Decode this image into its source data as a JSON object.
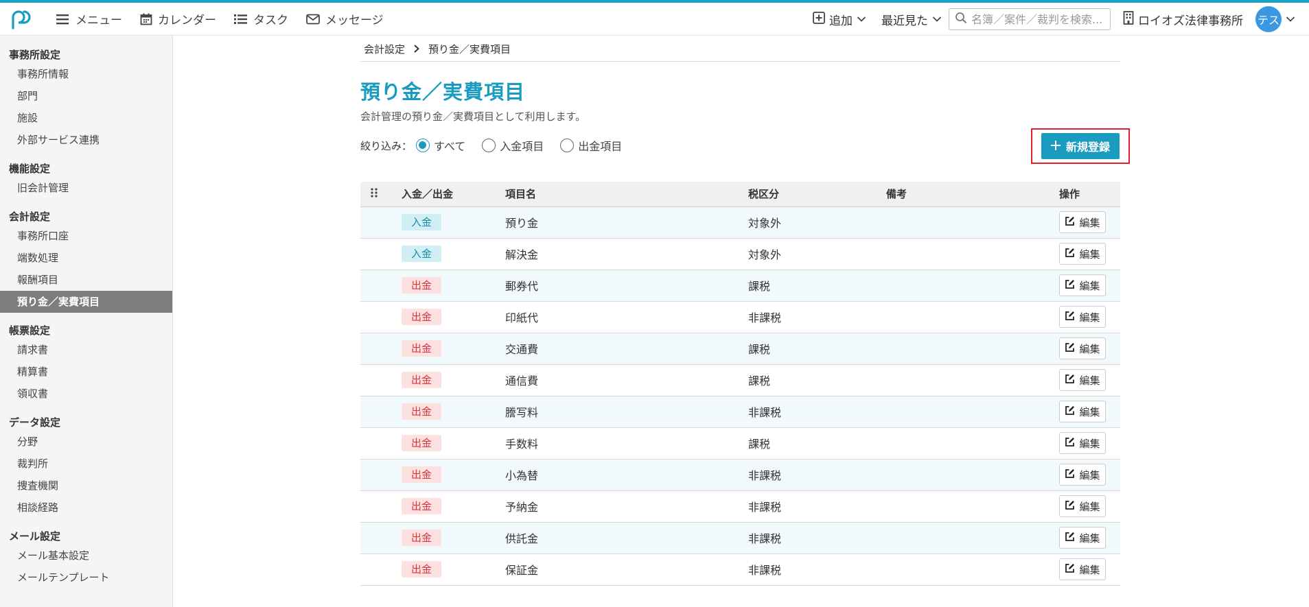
{
  "colors": {
    "accent": "#1a9bc0",
    "highlight": "#e0202a",
    "income": "#1a8aa8",
    "expense": "#d9363e"
  },
  "header": {
    "logo_icon": "app-logo-icon",
    "nav": [
      {
        "icon": "menu-icon",
        "label": "メニュー"
      },
      {
        "icon": "calendar-icon",
        "label": "カレンダー"
      },
      {
        "icon": "task-list-icon",
        "label": "タスク"
      },
      {
        "icon": "envelope-icon",
        "label": "メッセージ"
      }
    ],
    "add_label": "追加",
    "recent_label": "最近見た",
    "search_placeholder": "名簿／案件／裁判を検索...",
    "office_name": "ロイオズ法律事務所",
    "avatar_text": "テス"
  },
  "sidebar": {
    "groups": [
      {
        "title": "事務所設定",
        "items": [
          "事務所情報",
          "部門",
          "施設",
          "外部サービス連携"
        ]
      },
      {
        "title": "機能設定",
        "items": [
          "旧会計管理"
        ]
      },
      {
        "title": "会計設定",
        "items": [
          "事務所口座",
          "端数処理",
          "報酬項目",
          "預り金／実費項目"
        ]
      },
      {
        "title": "帳票設定",
        "items": [
          "請求書",
          "精算書",
          "領収書"
        ]
      },
      {
        "title": "データ設定",
        "items": [
          "分野",
          "裁判所",
          "捜査機関",
          "相談経路"
        ]
      },
      {
        "title": "メール設定",
        "items": [
          "メール基本設定",
          "メールテンプレート"
        ]
      }
    ],
    "active_item": "預り金／実費項目"
  },
  "main": {
    "breadcrumb": [
      "会計設定",
      "預り金／実費項目"
    ],
    "title": "預り金／実費項目",
    "description": "会計管理の預り金／実費項目として利用します。",
    "filter_label": "絞り込み：",
    "filters": [
      {
        "label": "すべて",
        "checked": true
      },
      {
        "label": "入金項目",
        "checked": false
      },
      {
        "label": "出金項目",
        "checked": false
      }
    ],
    "new_button_label": "新規登録",
    "table": {
      "columns": [
        "入金／出金",
        "項目名",
        "税区分",
        "備考",
        "操作"
      ],
      "edit_label": "編集",
      "rows": [
        {
          "type": "入金",
          "kind": "in",
          "name": "預り金",
          "tax": "対象外",
          "note": ""
        },
        {
          "type": "入金",
          "kind": "in",
          "name": "解決金",
          "tax": "対象外",
          "note": ""
        },
        {
          "type": "出金",
          "kind": "out",
          "name": "郵券代",
          "tax": "課税",
          "note": ""
        },
        {
          "type": "出金",
          "kind": "out",
          "name": "印紙代",
          "tax": "非課税",
          "note": ""
        },
        {
          "type": "出金",
          "kind": "out",
          "name": "交通費",
          "tax": "課税",
          "note": ""
        },
        {
          "type": "出金",
          "kind": "out",
          "name": "通信費",
          "tax": "課税",
          "note": ""
        },
        {
          "type": "出金",
          "kind": "out",
          "name": "謄写料",
          "tax": "非課税",
          "note": ""
        },
        {
          "type": "出金",
          "kind": "out",
          "name": "手数料",
          "tax": "課税",
          "note": ""
        },
        {
          "type": "出金",
          "kind": "out",
          "name": "小為替",
          "tax": "非課税",
          "note": ""
        },
        {
          "type": "出金",
          "kind": "out",
          "name": "予納金",
          "tax": "非課税",
          "note": ""
        },
        {
          "type": "出金",
          "kind": "out",
          "name": "供託金",
          "tax": "非課税",
          "note": ""
        },
        {
          "type": "出金",
          "kind": "out",
          "name": "保証金",
          "tax": "非課税",
          "note": ""
        }
      ]
    }
  }
}
